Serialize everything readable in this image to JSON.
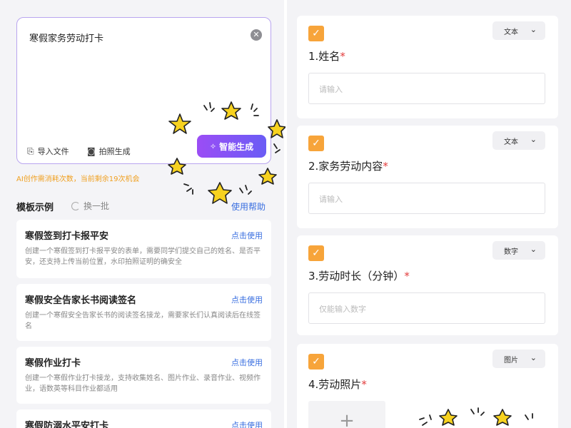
{
  "left": {
    "prompt_value": "寒假家务劳动打卡",
    "clear_icon": "close-circle-icon",
    "import_label": "导入文件",
    "photo_label": "拍照生成",
    "generate_label": "智能生成",
    "quota_text": "AI创作需消耗次数，当前剩余19次机会",
    "section_title": "模板示例",
    "refresh_label": "换一批",
    "help_label": "使用帮助",
    "templates": [
      {
        "title": "寒假签到打卡报平安",
        "use": "点击使用",
        "desc": "创建一个寒假签到打卡报平安的表单，需要同学们提交自己的姓名、是否平安，还支持上传当前位置，水印拍照证明的确安全"
      },
      {
        "title": "寒假安全告家长书阅读签名",
        "use": "点击使用",
        "desc": "创建一个寒假安全告家长书的阅读签名接龙，需要家长们认真阅读后在线签名"
      },
      {
        "title": "寒假作业打卡",
        "use": "点击使用",
        "desc": "创建一个寒假作业打卡接龙，支持收集姓名、图片作业、录音作业、视频作业，语数英等科目作业都适用"
      },
      {
        "title": "寒假防溺水平安打卡",
        "use": "点击使用",
        "desc": ""
      }
    ]
  },
  "right": {
    "questions": [
      {
        "type": "文本",
        "title": "1.姓名",
        "required": "*",
        "placeholder": "请输入"
      },
      {
        "type": "文本",
        "title": "2.家务劳动内容",
        "required": "*",
        "placeholder": "请输入"
      },
      {
        "type": "数字",
        "title": "3.劳动时长（分钟）",
        "required": "*",
        "placeholder": "仅能输入数字"
      },
      {
        "type": "图片",
        "title": "4.劳动照片",
        "required": "*",
        "placeholder": "+"
      }
    ]
  },
  "colors": {
    "accent_purple": "#8a55f5",
    "quota_orange": "#f0a020",
    "link_blue": "#3a6fe0",
    "checkbox_orange": "#f7a43a",
    "required_red": "#e23c3c"
  }
}
